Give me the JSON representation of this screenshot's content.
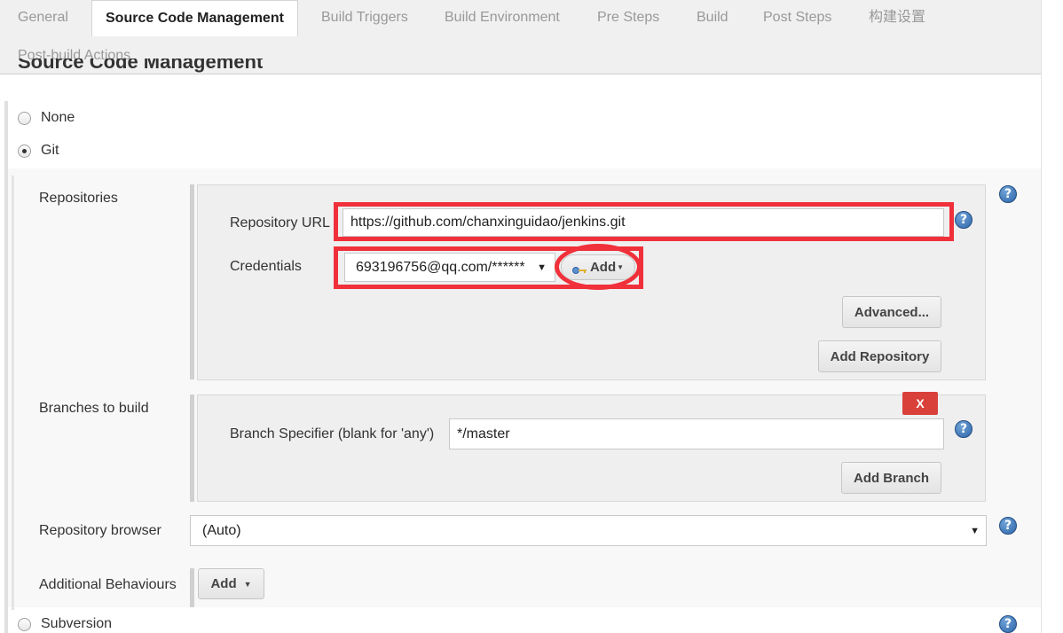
{
  "tabs": [
    {
      "label": "General",
      "active": false
    },
    {
      "label": "Source Code Management",
      "active": true
    },
    {
      "label": "Build Triggers",
      "active": false
    },
    {
      "label": "Build Environment",
      "active": false
    },
    {
      "label": "Pre Steps",
      "active": false
    },
    {
      "label": "Build",
      "active": false
    },
    {
      "label": "Post Steps",
      "active": false
    },
    {
      "label": "构建设置",
      "active": false
    },
    {
      "label": "Post-build Actions",
      "active": false
    }
  ],
  "section_heading": "Source Code Management",
  "scm_options": {
    "none": "None",
    "git": "Git",
    "subversion": "Subversion",
    "selected": "Git"
  },
  "repositories": {
    "label": "Repositories",
    "url_label": "Repository URL",
    "url_value": "https://github.com/chanxinguidao/jenkins.git",
    "credentials_label": "Credentials",
    "credentials_value": "693196756@qq.com/******",
    "add_credentials_button": "Add",
    "advanced_button": "Advanced...",
    "add_repository_button": "Add Repository"
  },
  "branches": {
    "label": "Branches to build",
    "delete_button": "X",
    "specifier_label": "Branch Specifier (blank for 'any')",
    "specifier_value": "*/master",
    "add_branch_button": "Add Branch"
  },
  "repository_browser": {
    "label": "Repository browser",
    "value": "(Auto)"
  },
  "additional_behaviours": {
    "label": "Additional Behaviours",
    "add_button": "Add"
  },
  "help_icon": "?",
  "dropdown_arrow": "▼",
  "colors": {
    "highlight": "#f0303a",
    "help": "#2e66a8",
    "delete": "#d9403a"
  }
}
